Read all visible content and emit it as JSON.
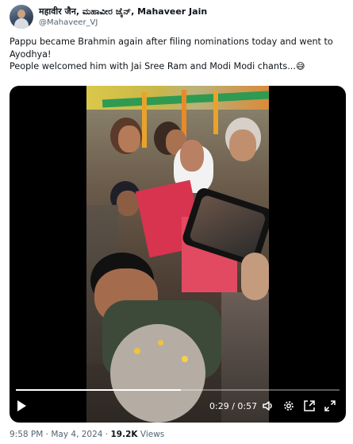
{
  "author": {
    "display_name": "महावीर जैन, ಮಹಾವೀರ ಜೈನ್, Mahaveer Jain",
    "handle": "@Mahaveer_VJ",
    "avatar_icon": "profile-photo"
  },
  "tweet": {
    "lines": [
      "Pappu became Brahmin again after filing nominations today and went to Ayodhya!",
      "People welcomed him with Jai Sree Ram and Modi Modi chants...😅"
    ]
  },
  "video": {
    "current_time": "0:29",
    "duration": "0:57",
    "time_display": "0:29 / 0:57",
    "progress_fraction": 0.509,
    "controls": [
      "play-icon",
      "volume-icon",
      "settings-icon",
      "picture-in-picture-icon",
      "fullscreen-icon"
    ]
  },
  "meta": {
    "time": "9:58 PM",
    "separator": "·",
    "date": "May 4, 2024",
    "views_count": "19.2K",
    "views_label": "Views"
  }
}
